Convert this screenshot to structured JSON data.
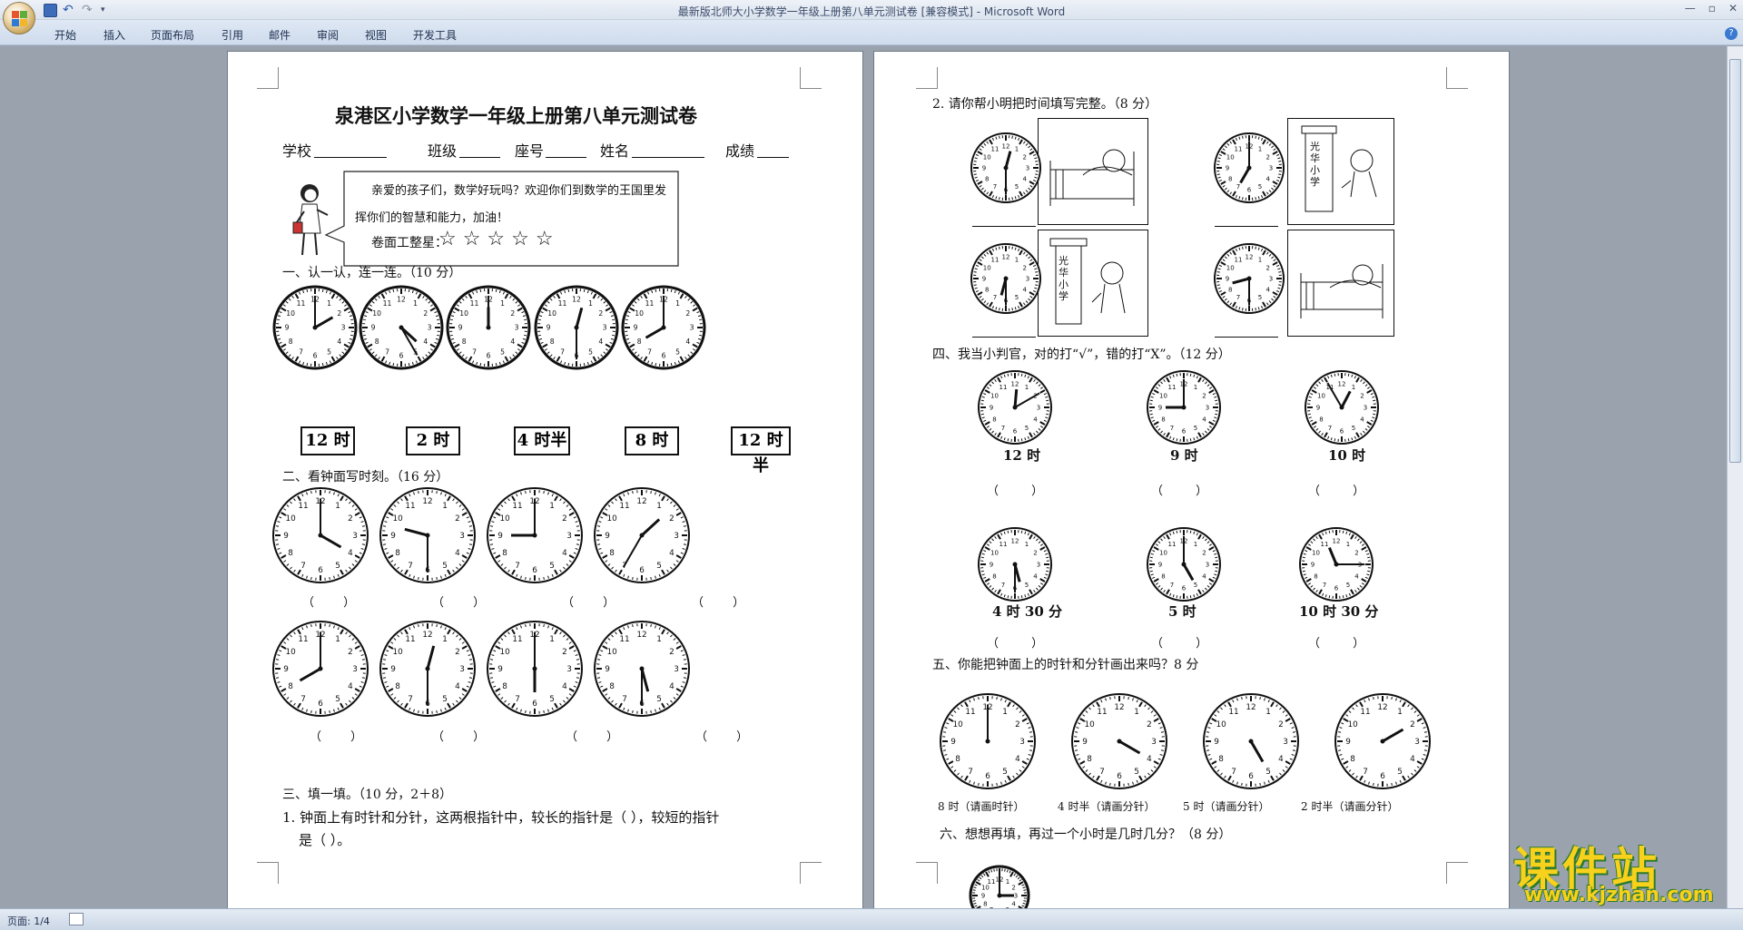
{
  "window": {
    "title": "最新版北师大小学数学一年级上册第八单元测试卷 [兼容模式] - Microsoft Word"
  },
  "ribbon": {
    "tabs": [
      "开始",
      "插入",
      "页面布局",
      "引用",
      "邮件",
      "审阅",
      "视图",
      "开发工具"
    ]
  },
  "status": {
    "page": "页面: 1/4"
  },
  "page1": {
    "title": "泉港区小学数学一年级上册第八单元测试卷",
    "info": {
      "school": "学校",
      "class": "班级",
      "seat": "座号",
      "name": "姓名",
      "score": "成绩"
    },
    "speech": {
      "line1": "亲爱的孩子们，数学好玩吗？欢迎你们到数学的王国里发",
      "line2": "挥你们的智慧和能力，加油！",
      "neat": "卷面工整星：",
      "stars": "☆ ☆ ☆ ☆ ☆"
    },
    "s1_title": "一、认一认，连一连。（10 分）",
    "s1_labels": [
      "12 时",
      "2 时",
      "4 时半",
      "8 时",
      "12 时半"
    ],
    "s2_title": "二、看钟面写时刻。（16 分）",
    "s2_paren": "（ ）",
    "s3_title": "三、填一填。（10 分，2＋8）",
    "s3_q1_line1": "1. 钟面上有时针和分针，这两根指针中，较长的指针是（ ），较短的指针",
    "s3_q1_line2": "是（ ）。"
  },
  "page2": {
    "q2_title": "2. 请你帮小明把时间填写完整。（8 分）",
    "school_text": "光华小学",
    "s4_title": "四、我当小判官，对的打“√”，错的打“X”。（12 分）",
    "s4_labels": [
      "12 时",
      "9 时",
      "10 时",
      "4 时 30 分",
      "5 时",
      "10 时 30 分"
    ],
    "s4_paren": "（ ）",
    "s5_title": "五、你能把钟面上的时针和分针画出来吗？8 分",
    "s5_labels": [
      "8 时（请画时针）",
      "4 时半（请画分针）",
      "5 时（请画分针）",
      "2 时半（请画分针）"
    ],
    "s6_title": "六、想想再填，再过一个小时是几时几分？（8 分）"
  },
  "watermark": {
    "big": "课件站",
    "small": "www.kjzhan.com"
  }
}
